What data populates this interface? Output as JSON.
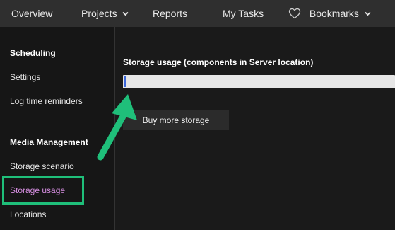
{
  "topnav": {
    "items": [
      {
        "label": "Overview"
      },
      {
        "label": "Projects"
      },
      {
        "label": "Reports"
      },
      {
        "label": "My Tasks"
      },
      {
        "label": "Bookmarks"
      }
    ]
  },
  "sidebar": {
    "sections": [
      {
        "heading": "Scheduling",
        "items": [
          "Settings",
          "Log time reminders"
        ]
      },
      {
        "heading": "Media Management",
        "items": [
          "Storage scenario",
          "Storage usage",
          "Locations"
        ]
      }
    ],
    "active_item": "Storage usage"
  },
  "main": {
    "usage_title": "Storage usage (components in Server location)",
    "usage_progress": 0,
    "buy_button_label": "Buy more storage"
  },
  "colors": {
    "nav_bg": "#2f2f2f",
    "page_bg": "#1a1a1a",
    "active_link": "#d58ee0",
    "annotation_green": "#1fbf7a",
    "progress_track": "#e6e6e6"
  }
}
